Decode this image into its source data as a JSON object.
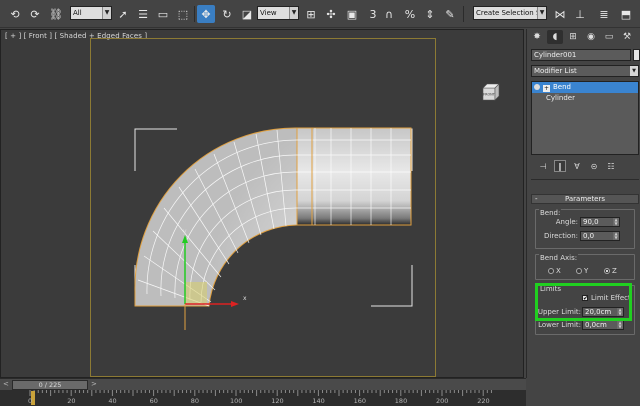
{
  "toolbar": {
    "filter_value": "All",
    "refcoord_value": "View",
    "snap_label": "3",
    "selection_set_placeholder": "Create Selection Se"
  },
  "viewport": {
    "label": "[ + ] [ Front ] [ Shaded + Edged Faces ]",
    "viewcube_text": "FRONT"
  },
  "command_panel": {
    "object_name": "Cylinder001",
    "modifier_list_label": "Modifier List",
    "stack": [
      {
        "label": "Bend",
        "selected": true
      },
      {
        "label": "Cylinder",
        "selected": false
      }
    ],
    "rollout_title": "Parameters",
    "bend_group_title": "Bend:",
    "angle_label": "Angle:",
    "angle_value": "90,0",
    "direction_label": "Direction:",
    "direction_value": "0,0",
    "bend_axis_title": "Bend Axis:",
    "axes": [
      {
        "label": "X",
        "selected": false
      },
      {
        "label": "Y",
        "selected": false
      },
      {
        "label": "Z",
        "selected": true
      }
    ],
    "limits_title": "Limits",
    "limit_effect_label": "Limit Effect",
    "limit_effect_checked": true,
    "upper_limit_label": "Upper Limit:",
    "upper_limit_value": "20,0cm",
    "lower_limit_label": "Lower Limit:",
    "lower_limit_value": "0,0cm"
  },
  "timeline": {
    "frame_display": "0 / 225",
    "ticks": [
      "0",
      "20",
      "40",
      "60",
      "80",
      "100",
      "120",
      "140",
      "160",
      "180",
      "200",
      "220"
    ]
  },
  "colors": {
    "accent": "#3a84d0",
    "highlight_box": "#20d020",
    "safe_frame": "#8c7a34",
    "gizmo_y": "#22cc22",
    "gizmo_x": "#dd2222",
    "selection_edges": "#e0a040"
  }
}
